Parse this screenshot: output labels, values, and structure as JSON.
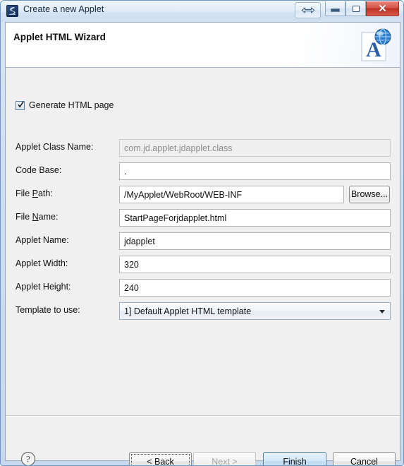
{
  "window": {
    "title": "Create a new Applet",
    "icon": "applet-app-icon",
    "controls": {
      "resize": "resize-arrows-icon",
      "minimize": "minimize-icon",
      "maximize": "maximize-icon",
      "close": "close-icon"
    }
  },
  "header": {
    "title": "Applet HTML Wizard",
    "icon": "applet-html-page-globe-icon"
  },
  "form": {
    "generate_checkbox": {
      "label": "Generate HTML page",
      "checked": true
    },
    "fields": [
      {
        "label": "Applet Class Name:",
        "mnemonic": "",
        "value": "com.jd.applet.jdapplet.class",
        "disabled": true
      },
      {
        "label": "Code Base:",
        "mnemonic": "",
        "value": ".",
        "disabled": false
      },
      {
        "label": "File Path:",
        "mnemonic": "P",
        "value": "/MyApplet/WebRoot/WEB-INF",
        "disabled": false
      },
      {
        "label": "File Name:",
        "mnemonic": "N",
        "value": "StartPageForjdapplet.html",
        "disabled": false
      },
      {
        "label": "Applet Name:",
        "mnemonic": "",
        "value": "jdapplet",
        "disabled": false
      },
      {
        "label": "Applet Width:",
        "mnemonic": "",
        "value": "320",
        "disabled": false
      },
      {
        "label": "Applet Height:",
        "mnemonic": "",
        "value": "240",
        "disabled": false
      }
    ],
    "browse_button": "Browse...",
    "template": {
      "label": "Template to use:",
      "selected": "1] Default Applet HTML template"
    }
  },
  "buttons": {
    "help": "help-icon",
    "back": {
      "label": "< Back",
      "mnemonic": "B",
      "focused": true,
      "disabled": false
    },
    "next": {
      "label": "Next >",
      "mnemonic": "N",
      "focused": false,
      "disabled": true
    },
    "finish": {
      "label": "Finish",
      "mnemonic": "F",
      "default": true,
      "disabled": false
    },
    "cancel": {
      "label": "Cancel",
      "mnemonic": "",
      "focused": false,
      "disabled": false
    }
  },
  "colors": {
    "frame": "#6f97c4",
    "dialog_bg": "#f0f0f0",
    "default_button": "#bcd9f2",
    "close_button": "#bf2f22"
  }
}
